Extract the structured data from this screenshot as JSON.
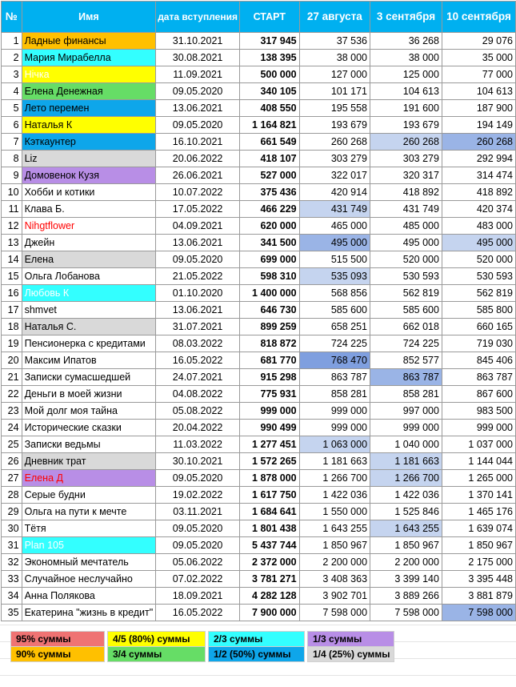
{
  "header": {
    "num": "№",
    "name": "Имя",
    "date": "дата вступления",
    "start": "СТАРТ",
    "c1": "27 августа",
    "c2": "3 сентября",
    "c3": "10 сентября"
  },
  "colors": {
    "header": "#00b0f0",
    "orange": "#ffc000",
    "cyan": "#33ffff",
    "yellow": "#ffff00",
    "green": "#66dd66",
    "blue": "#0ea6ea",
    "gray": "#d9d9d9",
    "purple": "#b88ee6",
    "red": "#ef7373",
    "hl_light": "#c5d4ef",
    "hl_mid": "#9ab4e6",
    "hl_dark": "#7f9fdf",
    "red_text": "#ff0000",
    "white_text": "#ffffff"
  },
  "rows": [
    {
      "n": "1",
      "name": "Ладные финансы",
      "date": "31.10.2021",
      "start": "317 945",
      "c1": "37 536",
      "c2": "36 268",
      "c3": "29 076",
      "bg": "orange"
    },
    {
      "n": "2",
      "name": "Мария Мирабелла",
      "date": "30.08.2021",
      "start": "138 395",
      "c1": "38 000",
      "c2": "38 000",
      "c3": "35 000",
      "bg": "cyan"
    },
    {
      "n": "3",
      "name": "Нічка",
      "date": "11.09.2021",
      "start": "500 000",
      "c1": "127 000",
      "c2": "125 000",
      "c3": "77 000",
      "bg": "yellow",
      "tc": "white_text"
    },
    {
      "n": "4",
      "name": "Елена Денежная",
      "date": "09.05.2020",
      "start": "340 105",
      "c1": "101 171",
      "c2": "104 613",
      "c3": "104 613",
      "bg": "green"
    },
    {
      "n": "5",
      "name": "Лето перемен",
      "date": "13.06.2021",
      "start": "408 550",
      "c1": "195 558",
      "c2": "191 600",
      "c3": "187 900",
      "bg": "blue"
    },
    {
      "n": "6",
      "name": "Наталья К",
      "date": "09.05.2020",
      "start": "1 164 821",
      "c1": "193 679",
      "c2": "193 679",
      "c3": "194 149",
      "bg": "yellow"
    },
    {
      "n": "7",
      "name": "Кэткаунтер",
      "date": "16.10.2021",
      "start": "661 549",
      "c1": "260 268",
      "c2": "260 268",
      "c3": "260 268",
      "bg": "blue",
      "h2": "hl_light",
      "h3": "hl_mid"
    },
    {
      "n": "8",
      "name": "Liz",
      "date": "20.06.2022",
      "start": "418 107",
      "c1": "303 279",
      "c2": "303 279",
      "c3": "292 994",
      "bg": "gray"
    },
    {
      "n": "9",
      "name": "Домовенок Кузя",
      "date": "26.06.2021",
      "start": "527 000",
      "c1": "322 017",
      "c2": "320 317",
      "c3": "314 474",
      "bg": "purple"
    },
    {
      "n": "10",
      "name": "Хобби и котики",
      "date": "10.07.2022",
      "start": "375 436",
      "c1": "420 914",
      "c2": "418 892",
      "c3": "418 892"
    },
    {
      "n": "11",
      "name": "Клава Б.",
      "date": "17.05.2022",
      "start": "466 229",
      "c1": "431 749",
      "c2": "431 749",
      "c3": "420 374",
      "h1": "hl_light"
    },
    {
      "n": "12",
      "name": "Nihgtflower",
      "date": "04.09.2021",
      "start": "620 000",
      "c1": "465 000",
      "c2": "485 000",
      "c3": "483 000",
      "tc": "red_text"
    },
    {
      "n": "13",
      "name": "Джейн",
      "date": "13.06.2021",
      "start": "341 500",
      "c1": "495 000",
      "c2": "495 000",
      "c3": "495 000",
      "h1": "hl_mid",
      "h3": "hl_light"
    },
    {
      "n": "14",
      "name": "Елена",
      "date": "09.05.2020",
      "start": "699 000",
      "c1": "515 500",
      "c2": "520 000",
      "c3": "520 000",
      "bg": "gray"
    },
    {
      "n": "15",
      "name": "Ольга Лобанова",
      "date": "21.05.2022",
      "start": "598 310",
      "c1": "535 093",
      "c2": "530 593",
      "c3": "530 593",
      "h1": "hl_light"
    },
    {
      "n": "16",
      "name": "Любовь К",
      "date": "01.10.2020",
      "start": "1 400 000",
      "c1": "568 856",
      "c2": "562 819",
      "c3": "562 819",
      "bg": "cyan",
      "tc": "white_text"
    },
    {
      "n": "17",
      "name": "shmvet",
      "date": "13.06.2021",
      "start": "646 730",
      "c1": "585 600",
      "c2": "585 600",
      "c3": "585 800"
    },
    {
      "n": "18",
      "name": "Наталья С.",
      "date": "31.07.2021",
      "start": "899 259",
      "c1": "658 251",
      "c2": "662 018",
      "c3": "660 165",
      "bg": "gray"
    },
    {
      "n": "19",
      "name": "Пенсионерка с кредитами",
      "date": "08.03.2022",
      "start": "818 872",
      "c1": "724 225",
      "c2": "724 225",
      "c3": "719 030"
    },
    {
      "n": "20",
      "name": "Максим Ипатов",
      "date": "16.05.2022",
      "start": "681 770",
      "c1": "768 470",
      "c2": "852 577",
      "c3": "845 406",
      "h1": "hl_dark"
    },
    {
      "n": "21",
      "name": "Записки сумасшедшей",
      "date": "24.07.2021",
      "start": "915 298",
      "c1": "863 787",
      "c2": "863 787",
      "c3": "863 787",
      "h2": "hl_mid"
    },
    {
      "n": "22",
      "name": "Деньги в моей жизни",
      "date": "04.08.2022",
      "start": "775 931",
      "c1": "858 281",
      "c2": "858 281",
      "c3": "867 600"
    },
    {
      "n": "23",
      "name": "Мой долг моя тайна",
      "date": "05.08.2022",
      "start": "999 000",
      "c1": "999 000",
      "c2": "997 000",
      "c3": "983 500"
    },
    {
      "n": "24",
      "name": "Исторические сказки",
      "date": "20.04.2022",
      "start": "990 499",
      "c1": "999 000",
      "c2": "999 000",
      "c3": "999 000"
    },
    {
      "n": "25",
      "name": "Записки ведьмы",
      "date": "11.03.2022",
      "start": "1 277 451",
      "c1": "1 063 000",
      "c2": "1 040 000",
      "c3": "1 037 000",
      "h1": "hl_light"
    },
    {
      "n": "26",
      "name": "Дневник трат",
      "date": "30.10.2021",
      "start": "1 572 265",
      "c1": "1 181 663",
      "c2": "1 181 663",
      "c3": "1 144 044",
      "bg": "gray",
      "h2": "hl_light"
    },
    {
      "n": "27",
      "name": "Елена Д",
      "date": "09.05.2020",
      "start": "1 878 000",
      "c1": "1 266 700",
      "c2": "1 266 700",
      "c3": "1 265 000",
      "bg": "purple",
      "tc": "red_text",
      "h2": "hl_light"
    },
    {
      "n": "28",
      "name": "Серые будни",
      "date": "19.02.2022",
      "start": "1 617 750",
      "c1": "1 422 036",
      "c2": "1 422 036",
      "c3": "1 370 141"
    },
    {
      "n": "29",
      "name": "Ольга на пути к мечте",
      "date": "03.11.2021",
      "start": "1 684 641",
      "c1": "1 550 000",
      "c2": "1 525 846",
      "c3": "1 465 176"
    },
    {
      "n": "30",
      "name": "Тётя",
      "date": "09.05.2020",
      "start": "1 801 438",
      "c1": "1 643 255",
      "c2": "1 643 255",
      "c3": "1 639 074",
      "h2": "hl_light"
    },
    {
      "n": "31",
      "name": "Plan 105",
      "date": "09.05.2020",
      "start": "5 437 744",
      "c1": "1 850 967",
      "c2": "1 850 967",
      "c3": "1 850 967",
      "bg": "cyan",
      "tc": "white_text"
    },
    {
      "n": "32",
      "name": "Экономный мечтатель",
      "date": "05.06.2022",
      "start": "2 372 000",
      "c1": "2 200 000",
      "c2": "2 200 000",
      "c3": "2 175 000"
    },
    {
      "n": "33",
      "name": "Случайное неслучайно",
      "date": "07.02.2022",
      "start": "3 781 271",
      "c1": "3 408 363",
      "c2": "3 399 140",
      "c3": "3 395 448"
    },
    {
      "n": "34",
      "name": "Анна Полякова",
      "date": "18.09.2021",
      "start": "4 282 128",
      "c1": "3 902 701",
      "c2": "3 889 266",
      "c3": "3 881 879"
    },
    {
      "n": "35",
      "name": "Екатерина \"жизнь в кредит\"",
      "date": "16.05.2022",
      "start": "7 900 000",
      "c1": "7 598 000",
      "c2": "7 598 000",
      "c3": "7 598 000",
      "h3": "hl_mid"
    }
  ],
  "legend": [
    [
      {
        "label": "95% суммы",
        "bg": "red"
      },
      {
        "label": "4/5 (80%) суммы",
        "bg": "yellow"
      },
      {
        "label": "2/3 суммы",
        "bg": "cyan"
      },
      {
        "label": "1/3 суммы",
        "bg": "purple"
      }
    ],
    [
      {
        "label": "90% суммы",
        "bg": "orange"
      },
      {
        "label": "3/4 суммы",
        "bg": "green"
      },
      {
        "label": "1/2 (50%) суммы",
        "bg": "blue"
      },
      {
        "label": "1/4 (25%) суммы",
        "bg": "gray"
      }
    ]
  ]
}
